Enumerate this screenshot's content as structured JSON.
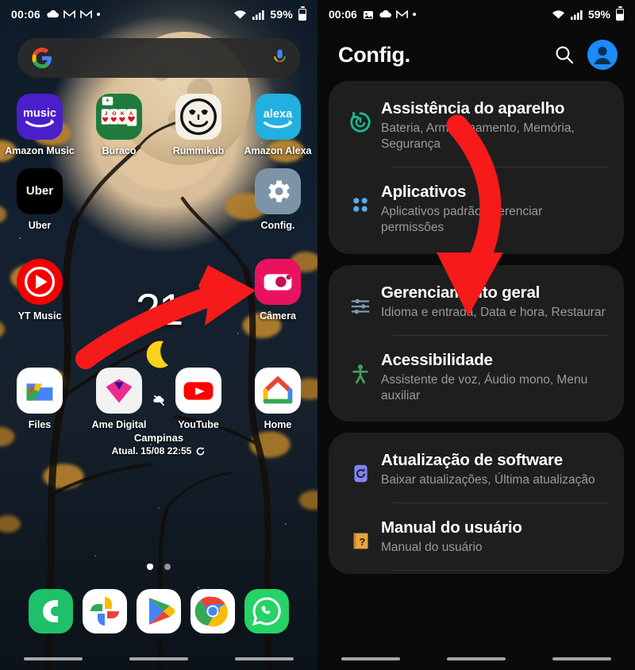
{
  "left_panel": {
    "statusbar": {
      "time": "00:06",
      "battery_percent": "59%",
      "icons": [
        "cloud-icon",
        "gmail-icon",
        "gmail-icon",
        "dot-icon"
      ],
      "right_icons": [
        "wifi-icon",
        "signal-icon",
        "battery-icon"
      ]
    },
    "search": {
      "placeholder": "",
      "left_icon": "google-g-icon",
      "right_icon": "microphone-icon"
    },
    "apps": [
      [
        {
          "label": "Amazon Music",
          "icon": "amazon-music-icon",
          "bg": "#4a1ecb"
        },
        {
          "label": "Buraco",
          "icon": "buraco-cards-icon",
          "bg": "#1f7a3d"
        },
        {
          "label": "Rummikub",
          "icon": "rummikub-face-icon",
          "bg": "#f5f0e6"
        },
        {
          "label": "Amazon Alexa",
          "icon": "amazon-alexa-icon",
          "bg": "#22b0e0"
        }
      ],
      [
        {
          "label": "Uber",
          "icon": "uber-icon",
          "bg": "#000000"
        },
        {
          "label": "",
          "icon": "",
          "bg": ""
        },
        {
          "label": "",
          "icon": "",
          "bg": ""
        },
        {
          "label": "Config.",
          "icon": "gear-icon",
          "bg": "#7d94a8"
        }
      ],
      [
        {
          "label": "YT Music",
          "icon": "youtube-music-icon",
          "bg": "#f40000"
        },
        {
          "label": "",
          "icon": "",
          "bg": ""
        },
        {
          "label": "",
          "icon": "",
          "bg": ""
        },
        {
          "label": "Câmera",
          "icon": "camera-icon",
          "bg": "#e8135e"
        }
      ],
      [
        {
          "label": "Files",
          "icon": "files-icon",
          "bg": "#ffffff"
        },
        {
          "label": "Ame Digital",
          "icon": "ame-digital-icon",
          "bg": "#f2f2f2"
        },
        {
          "label": "YouTube",
          "icon": "youtube-icon",
          "bg": "#ffffff"
        },
        {
          "label": "Home",
          "icon": "google-home-icon",
          "bg": "#ffffff"
        }
      ]
    ],
    "weather_widget": {
      "temperature": "21",
      "condition_icon": "crescent-moon-icon",
      "city": "Campinas",
      "updated": "Atual. 15/08 22:55",
      "refresh_icon": "refresh-icon"
    },
    "page_indicator": {
      "total": 2,
      "active": 1
    },
    "dock": [
      {
        "label": "Phone",
        "icon": "phone-icon",
        "bg": "#1ec16a"
      },
      {
        "label": "Google Photos",
        "icon": "google-photos-icon",
        "bg": "#ffffff"
      },
      {
        "label": "Play Store",
        "icon": "play-store-icon",
        "bg": "#ffffff"
      },
      {
        "label": "Chrome",
        "icon": "chrome-icon",
        "bg": "#ffffff"
      },
      {
        "label": "WhatsApp",
        "icon": "whatsapp-icon",
        "bg": "#25d366"
      }
    ],
    "annotation": {
      "type": "red-curved-arrow",
      "color": "#f61a1a",
      "points_to": "Config."
    }
  },
  "right_panel": {
    "statusbar": {
      "time": "00:06",
      "battery_percent": "59%",
      "icons": [
        "image-icon",
        "cloud-icon",
        "gmail-icon",
        "dot-icon"
      ],
      "right_icons": [
        "wifi-icon",
        "signal-icon",
        "battery-icon"
      ]
    },
    "header": {
      "title": "Config.",
      "search_icon": "search-icon",
      "account_icon": "account-avatar-icon"
    },
    "groups": [
      {
        "items": [
          {
            "title": "Assistência do aparelho",
            "desc": "Bateria, Armazenamento, Memória, Segurança",
            "icon": "device-care-icon",
            "icon_color": "#16b894"
          },
          {
            "title": "Aplicativos",
            "desc": "Aplicativos padrão, Gerenciar permissões",
            "icon": "apps-grid-icon",
            "icon_color": "#5aa9f0"
          }
        ]
      },
      {
        "items": [
          {
            "title": "Gerenciamento geral",
            "desc": "Idioma e entrada, Data e hora, Restaurar",
            "icon": "sliders-icon",
            "icon_color": "#7d99b8"
          },
          {
            "title": "Acessibilidade",
            "desc": "Assistente de voz, Áudio mono, Menu auxiliar",
            "icon": "accessibility-icon",
            "icon_color": "#3fa55a"
          }
        ]
      },
      {
        "items": [
          {
            "title": "Atualização de software",
            "desc": "Baixar atualizações, Última atualização",
            "icon": "software-update-icon",
            "icon_color": "#8186f0"
          },
          {
            "title": "Manual do usuário",
            "desc": "Manual do usuário",
            "icon": "user-manual-icon",
            "icon_color": "#e8a53e"
          }
        ]
      }
    ],
    "annotation": {
      "type": "red-curved-down-arrow",
      "color": "#f61a1a",
      "points_to": "Gerenciamento geral"
    }
  }
}
